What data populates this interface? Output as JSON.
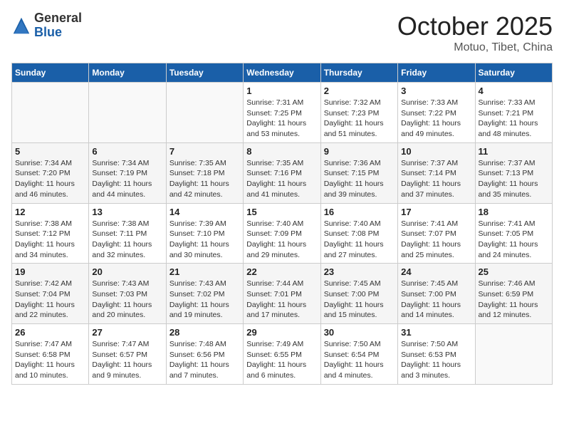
{
  "header": {
    "logo_general": "General",
    "logo_blue": "Blue",
    "month_title": "October 2025",
    "location": "Motuo, Tibet, China"
  },
  "days_of_week": [
    "Sunday",
    "Monday",
    "Tuesday",
    "Wednesday",
    "Thursday",
    "Friday",
    "Saturday"
  ],
  "weeks": [
    [
      {
        "day": "",
        "info": ""
      },
      {
        "day": "",
        "info": ""
      },
      {
        "day": "",
        "info": ""
      },
      {
        "day": "1",
        "info": "Sunrise: 7:31 AM\nSunset: 7:25 PM\nDaylight: 11 hours\nand 53 minutes."
      },
      {
        "day": "2",
        "info": "Sunrise: 7:32 AM\nSunset: 7:23 PM\nDaylight: 11 hours\nand 51 minutes."
      },
      {
        "day": "3",
        "info": "Sunrise: 7:33 AM\nSunset: 7:22 PM\nDaylight: 11 hours\nand 49 minutes."
      },
      {
        "day": "4",
        "info": "Sunrise: 7:33 AM\nSunset: 7:21 PM\nDaylight: 11 hours\nand 48 minutes."
      }
    ],
    [
      {
        "day": "5",
        "info": "Sunrise: 7:34 AM\nSunset: 7:20 PM\nDaylight: 11 hours\nand 46 minutes."
      },
      {
        "day": "6",
        "info": "Sunrise: 7:34 AM\nSunset: 7:19 PM\nDaylight: 11 hours\nand 44 minutes."
      },
      {
        "day": "7",
        "info": "Sunrise: 7:35 AM\nSunset: 7:18 PM\nDaylight: 11 hours\nand 42 minutes."
      },
      {
        "day": "8",
        "info": "Sunrise: 7:35 AM\nSunset: 7:16 PM\nDaylight: 11 hours\nand 41 minutes."
      },
      {
        "day": "9",
        "info": "Sunrise: 7:36 AM\nSunset: 7:15 PM\nDaylight: 11 hours\nand 39 minutes."
      },
      {
        "day": "10",
        "info": "Sunrise: 7:37 AM\nSunset: 7:14 PM\nDaylight: 11 hours\nand 37 minutes."
      },
      {
        "day": "11",
        "info": "Sunrise: 7:37 AM\nSunset: 7:13 PM\nDaylight: 11 hours\nand 35 minutes."
      }
    ],
    [
      {
        "day": "12",
        "info": "Sunrise: 7:38 AM\nSunset: 7:12 PM\nDaylight: 11 hours\nand 34 minutes."
      },
      {
        "day": "13",
        "info": "Sunrise: 7:38 AM\nSunset: 7:11 PM\nDaylight: 11 hours\nand 32 minutes."
      },
      {
        "day": "14",
        "info": "Sunrise: 7:39 AM\nSunset: 7:10 PM\nDaylight: 11 hours\nand 30 minutes."
      },
      {
        "day": "15",
        "info": "Sunrise: 7:40 AM\nSunset: 7:09 PM\nDaylight: 11 hours\nand 29 minutes."
      },
      {
        "day": "16",
        "info": "Sunrise: 7:40 AM\nSunset: 7:08 PM\nDaylight: 11 hours\nand 27 minutes."
      },
      {
        "day": "17",
        "info": "Sunrise: 7:41 AM\nSunset: 7:07 PM\nDaylight: 11 hours\nand 25 minutes."
      },
      {
        "day": "18",
        "info": "Sunrise: 7:41 AM\nSunset: 7:05 PM\nDaylight: 11 hours\nand 24 minutes."
      }
    ],
    [
      {
        "day": "19",
        "info": "Sunrise: 7:42 AM\nSunset: 7:04 PM\nDaylight: 11 hours\nand 22 minutes."
      },
      {
        "day": "20",
        "info": "Sunrise: 7:43 AM\nSunset: 7:03 PM\nDaylight: 11 hours\nand 20 minutes."
      },
      {
        "day": "21",
        "info": "Sunrise: 7:43 AM\nSunset: 7:02 PM\nDaylight: 11 hours\nand 19 minutes."
      },
      {
        "day": "22",
        "info": "Sunrise: 7:44 AM\nSunset: 7:01 PM\nDaylight: 11 hours\nand 17 minutes."
      },
      {
        "day": "23",
        "info": "Sunrise: 7:45 AM\nSunset: 7:00 PM\nDaylight: 11 hours\nand 15 minutes."
      },
      {
        "day": "24",
        "info": "Sunrise: 7:45 AM\nSunset: 7:00 PM\nDaylight: 11 hours\nand 14 minutes."
      },
      {
        "day": "25",
        "info": "Sunrise: 7:46 AM\nSunset: 6:59 PM\nDaylight: 11 hours\nand 12 minutes."
      }
    ],
    [
      {
        "day": "26",
        "info": "Sunrise: 7:47 AM\nSunset: 6:58 PM\nDaylight: 11 hours\nand 10 minutes."
      },
      {
        "day": "27",
        "info": "Sunrise: 7:47 AM\nSunset: 6:57 PM\nDaylight: 11 hours\nand 9 minutes."
      },
      {
        "day": "28",
        "info": "Sunrise: 7:48 AM\nSunset: 6:56 PM\nDaylight: 11 hours\nand 7 minutes."
      },
      {
        "day": "29",
        "info": "Sunrise: 7:49 AM\nSunset: 6:55 PM\nDaylight: 11 hours\nand 6 minutes."
      },
      {
        "day": "30",
        "info": "Sunrise: 7:50 AM\nSunset: 6:54 PM\nDaylight: 11 hours\nand 4 minutes."
      },
      {
        "day": "31",
        "info": "Sunrise: 7:50 AM\nSunset: 6:53 PM\nDaylight: 11 hours\nand 3 minutes."
      },
      {
        "day": "",
        "info": ""
      }
    ]
  ]
}
